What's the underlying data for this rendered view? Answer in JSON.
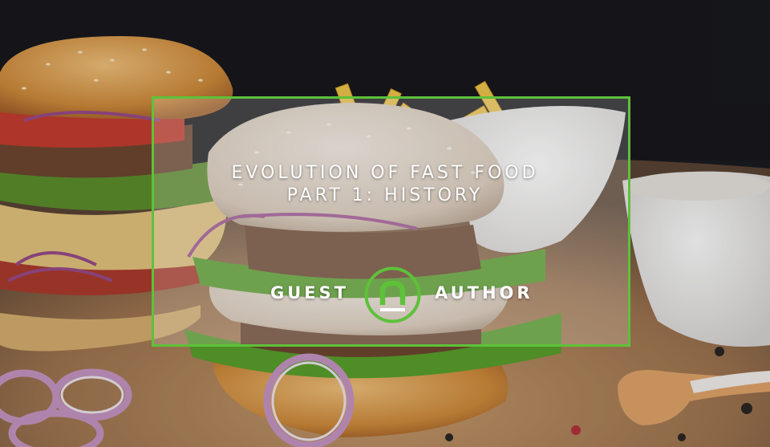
{
  "banner": {
    "title_line1": "EVOLUTION OF FAST FOOD",
    "title_line2": "PART 1: HISTORY",
    "byline_left": "GUEST",
    "byline_right": "AUTHOR",
    "accent_color": "#5ec13a",
    "logo_icon": "n-logo-icon"
  }
}
